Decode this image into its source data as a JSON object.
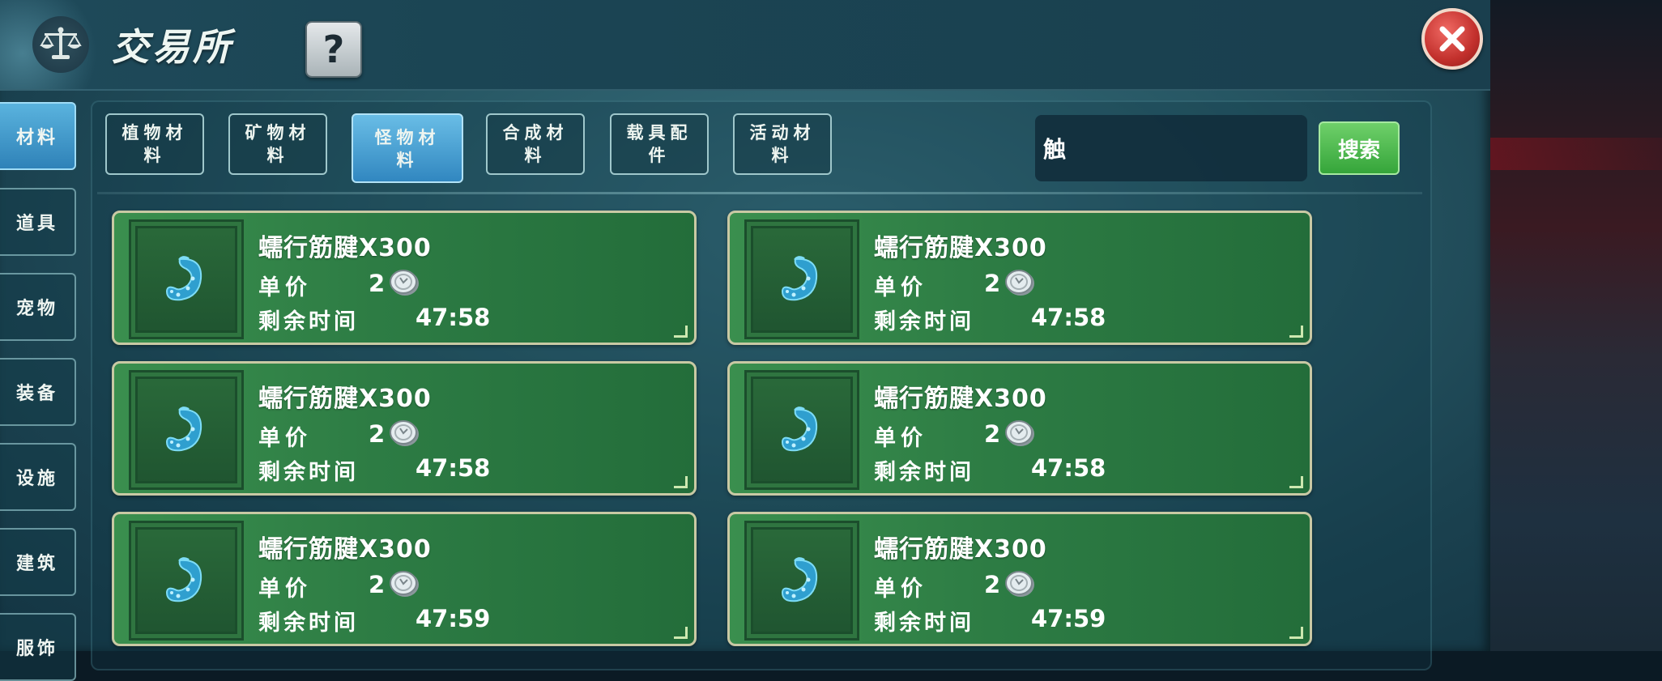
{
  "window": {
    "title": "交易所",
    "help_label": "?",
    "icons": {
      "title": "scale-icon",
      "help": "question-mark-icon",
      "close": "close-icon"
    }
  },
  "sidebar": {
    "items": [
      {
        "label": "材料",
        "active": true
      },
      {
        "label": "道具",
        "active": false
      },
      {
        "label": "宠物",
        "active": false
      },
      {
        "label": "装备",
        "active": false
      },
      {
        "label": "设施",
        "active": false
      },
      {
        "label": "建筑",
        "active": false
      },
      {
        "label": "服饰",
        "active": false
      }
    ]
  },
  "categories": [
    {
      "line1": "植物材",
      "line2": "料",
      "active": false
    },
    {
      "line1": "矿物材",
      "line2": "料",
      "active": false
    },
    {
      "line1": "怪物材",
      "line2": "料",
      "active": true
    },
    {
      "line1": "合成材",
      "line2": "料",
      "active": false
    },
    {
      "line1": "载具配",
      "line2": "件",
      "active": false
    },
    {
      "line1": "活动材",
      "line2": "料",
      "active": false
    }
  ],
  "search": {
    "value": "触",
    "button_label": "搜索"
  },
  "listings_labels": {
    "price": "单价",
    "time": "剩余时间"
  },
  "listings": [
    {
      "name": "蠕行筋腱X300",
      "price": "2",
      "time": "47:58",
      "icon": "tentacle-icon",
      "currency_icon": "silver-coin-icon"
    },
    {
      "name": "蠕行筋腱X300",
      "price": "2",
      "time": "47:58",
      "icon": "tentacle-icon",
      "currency_icon": "silver-coin-icon"
    },
    {
      "name": "蠕行筋腱X300",
      "price": "2",
      "time": "47:58",
      "icon": "tentacle-icon",
      "currency_icon": "silver-coin-icon"
    },
    {
      "name": "蠕行筋腱X300",
      "price": "2",
      "time": "47:58",
      "icon": "tentacle-icon",
      "currency_icon": "silver-coin-icon"
    },
    {
      "name": "蠕行筋腱X300",
      "price": "2",
      "time": "47:59",
      "icon": "tentacle-icon",
      "currency_icon": "silver-coin-icon"
    },
    {
      "name": "蠕行筋腱X300",
      "price": "2",
      "time": "47:59",
      "icon": "tentacle-icon",
      "currency_icon": "silver-coin-icon"
    }
  ],
  "colors": {
    "listing_green": "#2d7c44",
    "active_tab_blue": "#3187c0",
    "search_green": "#35a53a",
    "close_red": "#c2302c"
  }
}
